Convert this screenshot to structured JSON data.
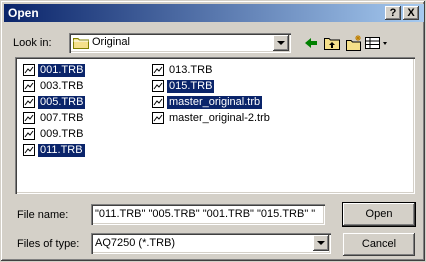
{
  "window": {
    "title": "Open",
    "help_label": "?",
    "close_label": "X"
  },
  "lookin": {
    "label": "Look in:",
    "value": "Original"
  },
  "files": [
    {
      "name": "001.TRB",
      "selected": true
    },
    {
      "name": "003.TRB",
      "selected": false
    },
    {
      "name": "005.TRB",
      "selected": true
    },
    {
      "name": "007.TRB",
      "selected": false
    },
    {
      "name": "009.TRB",
      "selected": false
    },
    {
      "name": "011.TRB",
      "selected": true
    },
    {
      "name": "013.TRB",
      "selected": false
    },
    {
      "name": "015.TRB",
      "selected": true
    },
    {
      "name": "master_original.trb",
      "selected": true
    },
    {
      "name": "master_original-2.trb",
      "selected": false
    }
  ],
  "filename": {
    "label": "File name:",
    "value": "\"011.TRB\" \"005.TRB\" \"001.TRB\" \"015.TRB\" \""
  },
  "filetype": {
    "label": "Files of type:",
    "value": "AQ7250 (*.TRB)"
  },
  "buttons": {
    "open": "Open",
    "cancel": "Cancel"
  },
  "colors": {
    "title_start": "#0a246a",
    "title_end": "#a6caf0",
    "selection": "#0a246a",
    "face": "#d4d0c8"
  }
}
